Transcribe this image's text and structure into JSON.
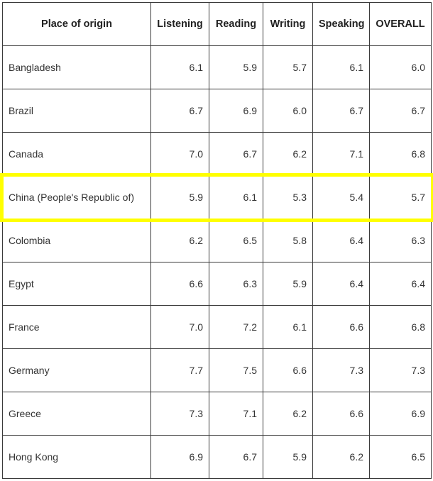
{
  "table": {
    "columns": [
      "Place of origin",
      "Listening",
      "Reading",
      "Writing",
      "Speaking",
      "OVERALL"
    ],
    "rows": [
      {
        "place": "Bangladesh",
        "listening": "6.1",
        "reading": "5.9",
        "writing": "5.7",
        "speaking": "6.1",
        "overall": "6.0",
        "highlighted": false
      },
      {
        "place": "Brazil",
        "listening": "6.7",
        "reading": "6.9",
        "writing": "6.0",
        "speaking": "6.7",
        "overall": "6.7",
        "highlighted": false
      },
      {
        "place": "Canada",
        "listening": "7.0",
        "reading": "6.7",
        "writing": "6.2",
        "speaking": "7.1",
        "overall": "6.8",
        "highlighted": false
      },
      {
        "place": "China (People's Republic of)",
        "listening": "5.9",
        "reading": "6.1",
        "writing": "5.3",
        "speaking": "5.4",
        "overall": "5.7",
        "highlighted": true
      },
      {
        "place": "Colombia",
        "listening": "6.2",
        "reading": "6.5",
        "writing": "5.8",
        "speaking": "6.4",
        "overall": "6.3",
        "highlighted": false
      },
      {
        "place": "Egypt",
        "listening": "6.6",
        "reading": "6.3",
        "writing": "5.9",
        "speaking": "6.4",
        "overall": "6.4",
        "highlighted": false
      },
      {
        "place": "France",
        "listening": "7.0",
        "reading": "7.2",
        "writing": "6.1",
        "speaking": "6.6",
        "overall": "6.8",
        "highlighted": false
      },
      {
        "place": "Germany",
        "listening": "7.7",
        "reading": "7.5",
        "writing": "6.6",
        "speaking": "7.3",
        "overall": "7.3",
        "highlighted": false
      },
      {
        "place": "Greece",
        "listening": "7.3",
        "reading": "7.1",
        "writing": "6.2",
        "speaking": "6.6",
        "overall": "6.9",
        "highlighted": false
      },
      {
        "place": "Hong Kong",
        "listening": "6.9",
        "reading": "6.7",
        "writing": "5.9",
        "speaking": "6.2",
        "overall": "6.5",
        "highlighted": false
      }
    ]
  },
  "highlight": {
    "color": "#ffff00",
    "row_index": 3,
    "border_width_px": 5
  },
  "colors": {
    "border": "#3a3a3a",
    "text": "#333333",
    "header_text": "#222222",
    "background": "#ffffff",
    "highlight": "#ffff00"
  }
}
